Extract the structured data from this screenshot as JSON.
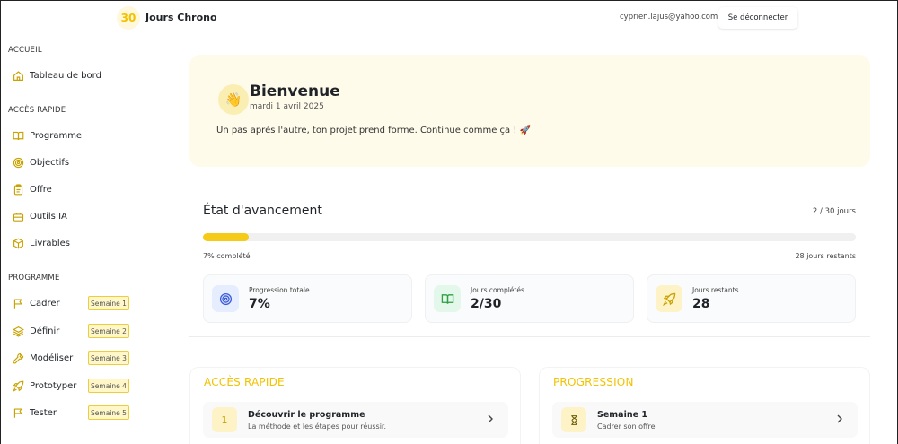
{
  "header": {
    "logo_number": "30",
    "logo_text": "Jours Chrono",
    "user_email": "cyprien.lajus@yahoo.com",
    "logout_label": "Se déconnecter"
  },
  "sidebar": {
    "sections": [
      {
        "label": "ACCUEIL"
      },
      {
        "label": "ACCÈS RAPIDE"
      },
      {
        "label": "PROGRAMME"
      }
    ],
    "home_items": [
      {
        "label": "Tableau de bord",
        "icon": "home-icon"
      }
    ],
    "quick_items": [
      {
        "label": "Programme",
        "icon": "book-icon"
      },
      {
        "label": "Objectifs",
        "icon": "target-icon"
      },
      {
        "label": "Offre",
        "icon": "clipboard-icon"
      },
      {
        "label": "Outils IA",
        "icon": "briefcase-icon"
      },
      {
        "label": "Livrables",
        "icon": "package-icon"
      }
    ],
    "program_items": [
      {
        "label": "Cadrer",
        "badge": "Semaine 1",
        "icon": "flag-icon"
      },
      {
        "label": "Définir",
        "badge": "Semaine 2",
        "icon": "layers-icon"
      },
      {
        "label": "Modéliser",
        "badge": "Semaine 3",
        "icon": "wrench-icon"
      },
      {
        "label": "Prototyper",
        "badge": "Semaine 4",
        "icon": "rocket-icon"
      },
      {
        "label": "Tester",
        "badge": "Semaine 5",
        "icon": "flag-icon"
      }
    ]
  },
  "welcome": {
    "title": "Bienvenue",
    "date": "mardi 1 avril 2025",
    "message": "Un pas après l'autre, ton projet prend forme. Continue comme ça ! 🚀",
    "icon": "waving-hand-icon"
  },
  "progress": {
    "title": "État d'avancement",
    "days_label": "2 / 30 jours",
    "percent_value": 0.07,
    "percent_label": "7% complété",
    "remaining_label": "28 jours restants",
    "stats": [
      {
        "label": "Progression totale",
        "value": "7%",
        "icon": "target-icon",
        "color": "#e5edff",
        "stroke": "#3b5bdb"
      },
      {
        "label": "Jours complétés",
        "value": "2/30",
        "icon": "book-open-icon",
        "color": "#e3f8ea",
        "stroke": "#2f9e44"
      },
      {
        "label": "Jours restants",
        "value": "28",
        "icon": "rocket-icon",
        "color": "#fdf3c7",
        "stroke": "#c9a200"
      }
    ]
  },
  "quick_access": {
    "title": "ACCÈS RAPIDE",
    "item": {
      "number": "1",
      "title": "Découvrir le programme",
      "subtitle": "La méthode et les étapes pour réussir."
    }
  },
  "progression": {
    "title": "PROGRESSION",
    "item": {
      "title": "Semaine 1",
      "subtitle": "Cadrer son offre",
      "icon": "hourglass-icon"
    }
  },
  "colors": {
    "accent": "#f5cb17",
    "accent_text": "#f2c200"
  }
}
